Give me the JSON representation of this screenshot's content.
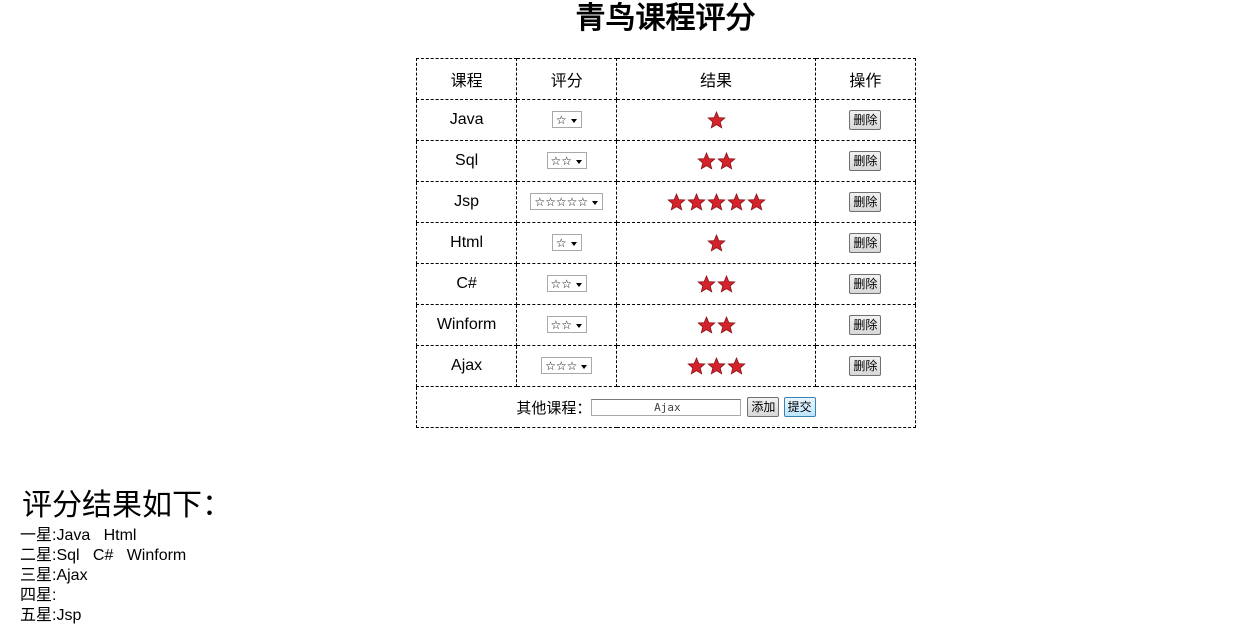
{
  "page_title": "青鸟课程评分",
  "table": {
    "headers": [
      "课程",
      "评分",
      "结果",
      "操作"
    ],
    "rows": [
      {
        "course": "Java",
        "rating_option": "☆",
        "stars": 1,
        "delete_label": "删除"
      },
      {
        "course": "Sql",
        "rating_option": "☆☆",
        "stars": 2,
        "delete_label": "删除"
      },
      {
        "course": "Jsp",
        "rating_option": "☆☆☆☆☆",
        "stars": 5,
        "delete_label": "删除"
      },
      {
        "course": "Html",
        "rating_option": "☆",
        "stars": 1,
        "delete_label": "删除"
      },
      {
        "course": "C#",
        "rating_option": "☆☆",
        "stars": 2,
        "delete_label": "删除"
      },
      {
        "course": "Winform",
        "rating_option": "☆☆",
        "stars": 2,
        "delete_label": "删除"
      },
      {
        "course": "Ajax",
        "rating_option": "☆☆☆",
        "stars": 3,
        "delete_label": "删除"
      }
    ],
    "footer": {
      "label": "其他课程：",
      "input_value": "Ajax",
      "add_label": "添加",
      "submit_label": "提交"
    }
  },
  "results": {
    "title": "评分结果如下：",
    "lines": [
      "一星:Java   Html",
      "二星:Sql   C#   Winform",
      "三星:Ajax",
      "四星:",
      "五星:Jsp"
    ]
  },
  "colors": {
    "star_fill": "#d4232b",
    "star_stroke": "#8a1015",
    "border": "#000000"
  }
}
